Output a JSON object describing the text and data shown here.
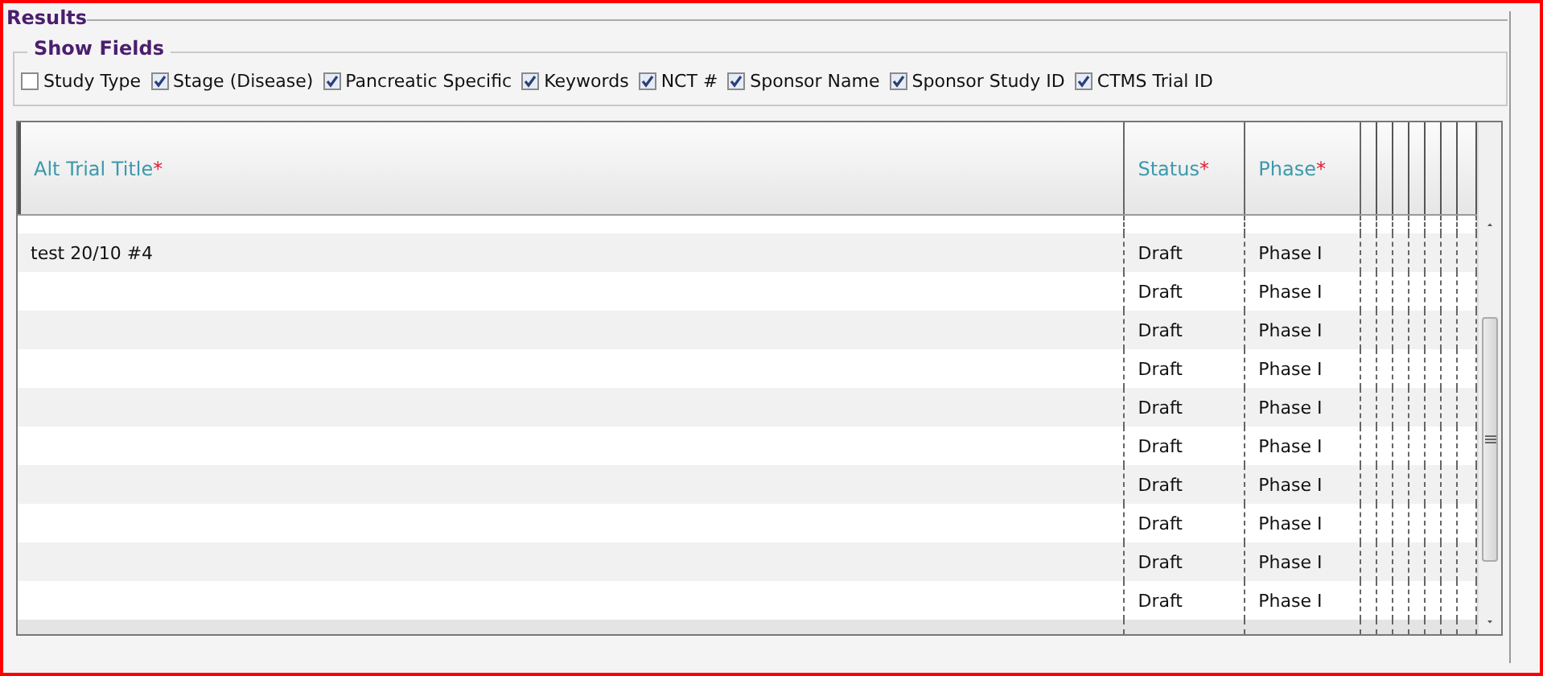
{
  "results": {
    "legend": "Results"
  },
  "show_fields": {
    "legend": "Show Fields",
    "fields": [
      {
        "label": "Study Type",
        "checked": false
      },
      {
        "label": "Stage (Disease)",
        "checked": true
      },
      {
        "label": "Pancreatic Specific",
        "checked": true
      },
      {
        "label": "Keywords",
        "checked": true
      },
      {
        "label": "NCT #",
        "checked": true
      },
      {
        "label": "Sponsor Name",
        "checked": true
      },
      {
        "label": "Sponsor Study ID",
        "checked": true
      },
      {
        "label": "CTMS Trial ID",
        "checked": true
      }
    ]
  },
  "table": {
    "columns": [
      {
        "label": "Alt Trial Title",
        "marker": "*"
      },
      {
        "label": "Status",
        "marker": "*"
      },
      {
        "label": "Phase",
        "marker": "*"
      }
    ],
    "rows": [
      {
        "title": "test 20/10 #4",
        "status": "Draft",
        "phase": "Phase I"
      },
      {
        "status": "Draft",
        "phase": "Phase I"
      },
      {
        "status": "Draft",
        "phase": "Phase I"
      },
      {
        "status": "Draft",
        "phase": "Phase I"
      },
      {
        "status": "Draft",
        "phase": "Phase I"
      },
      {
        "status": "Draft",
        "phase": "Phase I"
      },
      {
        "status": "Draft",
        "phase": "Phase I"
      },
      {
        "status": "Draft",
        "phase": "Phase I"
      },
      {
        "status": "Draft",
        "phase": "Phase I"
      },
      {
        "status": "Draft",
        "phase": "Phase I"
      }
    ]
  }
}
